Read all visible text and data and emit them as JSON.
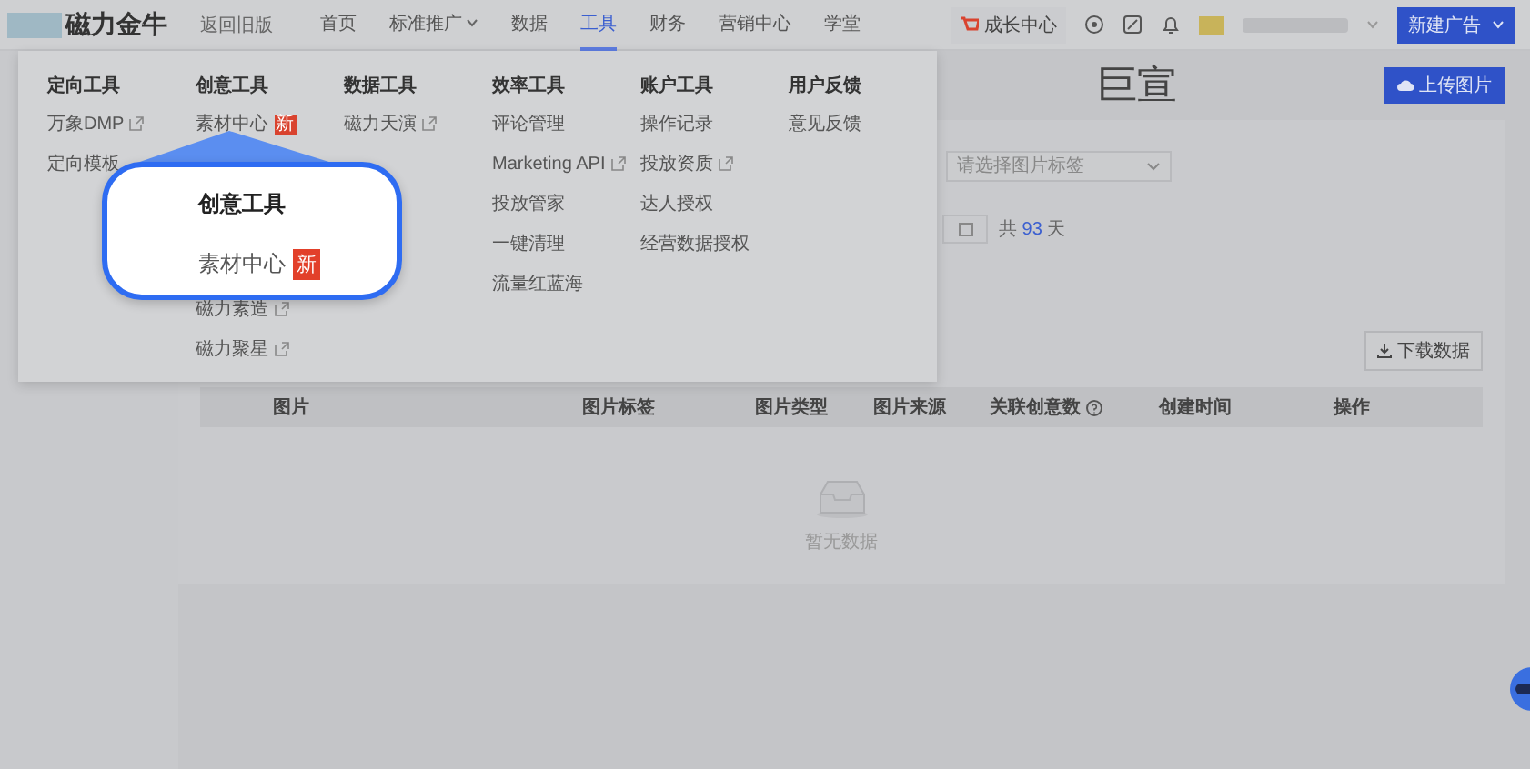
{
  "header": {
    "logo_text": "磁力金牛",
    "version_switch": "返回旧版",
    "nav": [
      {
        "label": "首页",
        "selected": false,
        "caret": false
      },
      {
        "label": "标准推广",
        "selected": false,
        "caret": true
      },
      {
        "label": "数据",
        "selected": false,
        "caret": false
      },
      {
        "label": "工具",
        "selected": true,
        "caret": false
      },
      {
        "label": "财务",
        "selected": false,
        "caret": false
      },
      {
        "label": "营销中心",
        "selected": false,
        "caret": false
      },
      {
        "label": "学堂",
        "selected": false,
        "caret": false
      }
    ],
    "growth_center": "成长中心",
    "new_ad_button": "新建广告"
  },
  "mega_menu": {
    "columns": [
      {
        "title": "定向工具",
        "items": [
          {
            "label": "万象DMP",
            "external": true
          },
          {
            "label": "定向模板",
            "external": false
          }
        ]
      },
      {
        "title": "创意工具",
        "items": [
          {
            "label": "素材中心",
            "external": false,
            "badge": "新"
          },
          {
            "label": "磁力素造",
            "external": true
          },
          {
            "label": "磁力聚星",
            "external": true
          }
        ]
      },
      {
        "title": "数据工具",
        "items": [
          {
            "label": "磁力天演",
            "external": true
          }
        ]
      },
      {
        "title": "效率工具",
        "items": [
          {
            "label": "评论管理",
            "external": false
          },
          {
            "label": "Marketing API",
            "external": true
          },
          {
            "label": "投放管家",
            "external": false
          },
          {
            "label": "一键清理",
            "external": false
          },
          {
            "label": "流量红蓝海",
            "external": false
          }
        ]
      },
      {
        "title": "账户工具",
        "items": [
          {
            "label": "操作记录",
            "external": false
          },
          {
            "label": "投放资质",
            "external": true
          },
          {
            "label": "达人授权",
            "external": false
          },
          {
            "label": "经营数据授权",
            "external": false
          }
        ]
      },
      {
        "title": "用户反馈",
        "items": [
          {
            "label": "意见反馈",
            "external": false
          }
        ]
      }
    ]
  },
  "callout": {
    "title": "创意工具",
    "item": "素材中心",
    "badge": "新"
  },
  "page": {
    "title": "巨宣",
    "upload_button": "上传图片",
    "tag_select": {
      "placeholder": "请选择图片标签"
    },
    "total": {
      "prefix": "共",
      "count": "93",
      "suffix": "天"
    },
    "download_button": "下载数据",
    "table": {
      "columns": [
        {
          "label": "图片",
          "help": false
        },
        {
          "label": "图片标签",
          "help": false
        },
        {
          "label": "图片类型",
          "help": false
        },
        {
          "label": "图片来源",
          "help": false
        },
        {
          "label": "关联创意数",
          "help": true
        },
        {
          "label": "创建时间",
          "help": false
        },
        {
          "label": "操作",
          "help": false
        }
      ]
    },
    "empty_text": "暂无数据"
  }
}
